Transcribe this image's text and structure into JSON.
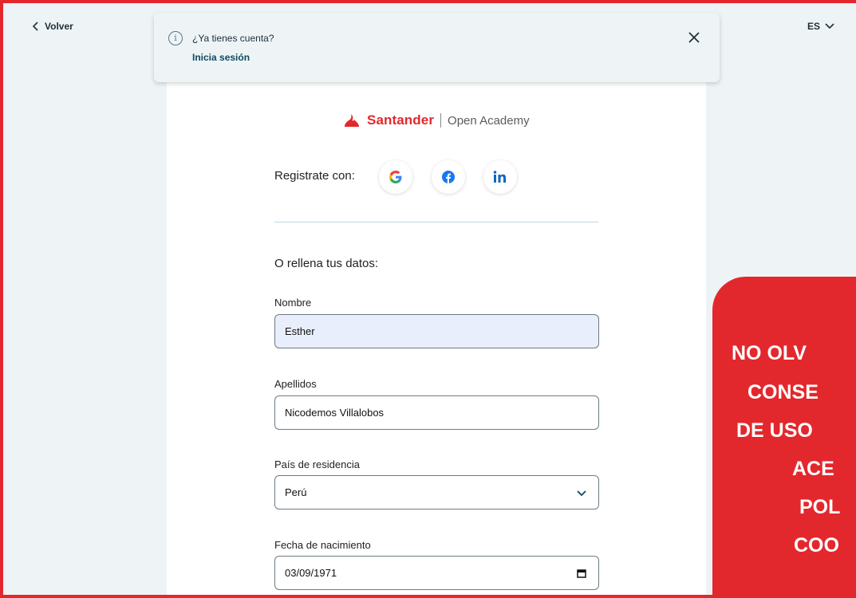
{
  "nav": {
    "back_label": "Volver",
    "language": "ES"
  },
  "notice": {
    "question": "¿Ya tienes cuenta?",
    "login_link": "Inicia sesión"
  },
  "brand": {
    "name": "Santander",
    "product": "Open Academy",
    "color": "#e3282d"
  },
  "social": {
    "label": "Registrate con:",
    "providers": [
      "google",
      "facebook",
      "linkedin"
    ]
  },
  "form": {
    "intro": "O rellena tus datos:",
    "nombre": {
      "label": "Nombre",
      "value": "Esther"
    },
    "apellidos": {
      "label": "Apellidos",
      "value": "Nicodemos Villalobos"
    },
    "pais": {
      "label": "País de residencia",
      "value": "Perú"
    },
    "fecha": {
      "label": "Fecha de nacimiento",
      "value": "03/09/1971"
    }
  },
  "promo": {
    "lines": [
      "NO OLV",
      "CONSE",
      "DE USO",
      "ACE",
      "POL",
      "COO"
    ]
  }
}
